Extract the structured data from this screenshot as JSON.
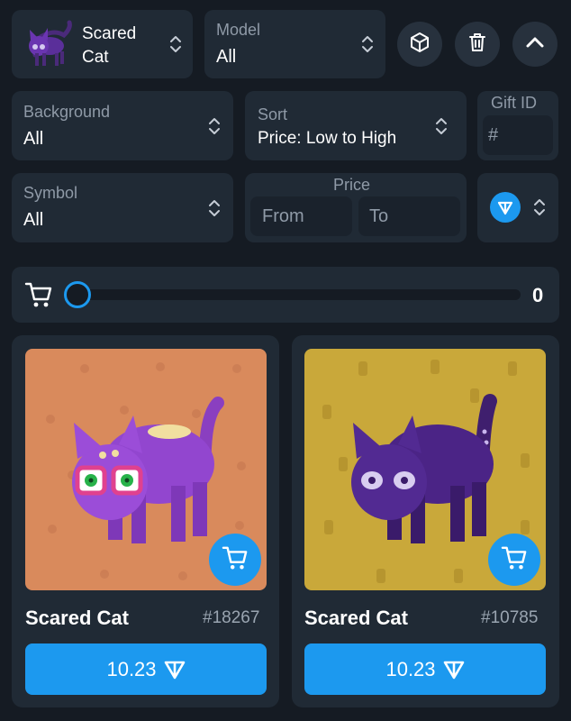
{
  "filters": {
    "gift": {
      "name": "Scared Cat"
    },
    "model": {
      "label": "Model",
      "value": "All"
    },
    "background": {
      "label": "Background",
      "value": "All"
    },
    "sort": {
      "label": "Sort",
      "value": "Price: Low to High"
    },
    "gift_id": {
      "label": "Gift ID",
      "placeholder": "#"
    },
    "symbol": {
      "label": "Symbol",
      "value": "All"
    },
    "price": {
      "label": "Price",
      "from_placeholder": "From",
      "to_placeholder": "To"
    }
  },
  "toolbar": {
    "icons": [
      "cube-icon",
      "trash-icon",
      "chevron-up-icon"
    ]
  },
  "cart": {
    "count": "0",
    "slider_fraction": 0
  },
  "colors": {
    "accent": "#1c99ef",
    "card_bg": "#202a35",
    "page_bg": "#151b23",
    "art1_bg": "#d98a5c",
    "art2_bg": "#c9a83a"
  },
  "items": [
    {
      "title": "Scared Cat",
      "id": "#18267",
      "price": "10.23"
    },
    {
      "title": "Scared Cat",
      "id": "#10785",
      "price": "10.23"
    }
  ]
}
